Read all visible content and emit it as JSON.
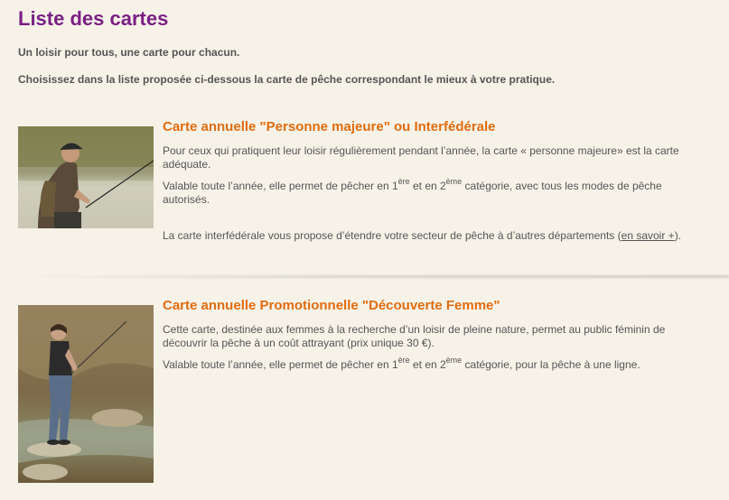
{
  "page": {
    "title": "Liste des cartes",
    "intro_1": "Un loisir pour tous, une carte pour chacun.",
    "intro_2": "Choisissez dans la liste proposée ci-dessous la carte de pêche correspondant le mieux à votre pratique."
  },
  "cards": [
    {
      "title": "Carte annuelle \"Personne majeure\" ou Interfédérale",
      "p1": "Pour ceux qui pratiquent leur loisir régulièrement pendant l’année, la carte « personne majeure» est la carte adéquate.",
      "p2_start": "Valable  toute l’année, elle permet de pêcher en 1",
      "p2_sup1": "ère",
      "p2_mid": " et en 2",
      "p2_sup2": "ème",
      "p2_end": " catégorie, avec tous les modes de pêche autorisés.",
      "p3_start": "La carte interfédérale vous propose d’étendre votre secteur de pêche à d’autres départements (",
      "p3_link": "en savoir +",
      "p3_end": ")."
    },
    {
      "title": "Carte annuelle Promotionnelle \"Découverte Femme\"",
      "p1": "Cette carte, destinée aux femmes à la recherche d’un loisir de pleine nature, permet au public féminin de découvrir la pêche à un coût attrayant (prix unique 30 €).",
      "p2_start": "Valable toute l’année, elle permet de pêcher en 1",
      "p2_sup1": "ère",
      "p2_mid": " et en 2",
      "p2_sup2": "ème",
      "p2_end": " catégorie, pour la pêche à une ligne."
    }
  ],
  "colors": {
    "background": "#f6f2e8",
    "title": "#7a2084",
    "card_title": "#e06c10",
    "text": "#555555"
  }
}
